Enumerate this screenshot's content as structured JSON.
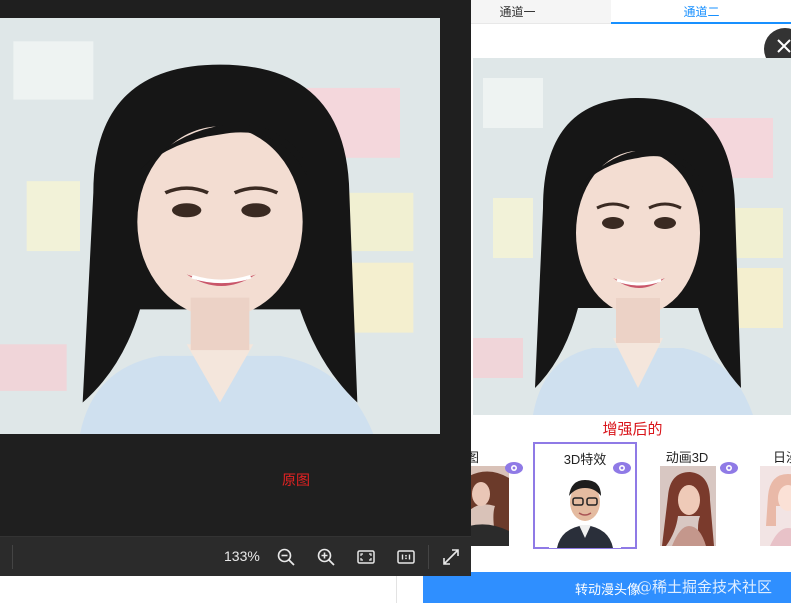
{
  "tabs": [
    {
      "label": "通道一",
      "active": false
    },
    {
      "label": "通道二",
      "active": true
    }
  ],
  "enhanced_label": "增强后的",
  "original_label": "原图",
  "effects": [
    {
      "label": "原图",
      "selected": false
    },
    {
      "label": "3D特效",
      "selected": true
    },
    {
      "label": "动画3D",
      "selected": false
    },
    {
      "label": "日漫",
      "selected": false
    }
  ],
  "action_button": "转动漫头像",
  "watermark": "@稀土掘金技术社区",
  "toolbar": {
    "zoom": "133%"
  },
  "colors": {
    "accent_blue": "#1890ff",
    "label_red": "#d9141a",
    "selected_border": "#8f7ae6",
    "viewer_bg": "#1f1f1f"
  },
  "icons": [
    "close-icon",
    "eye-icon",
    "zoom-out-icon",
    "zoom-in-icon",
    "fit-screen-icon",
    "actual-size-icon",
    "fullscreen-icon"
  ]
}
